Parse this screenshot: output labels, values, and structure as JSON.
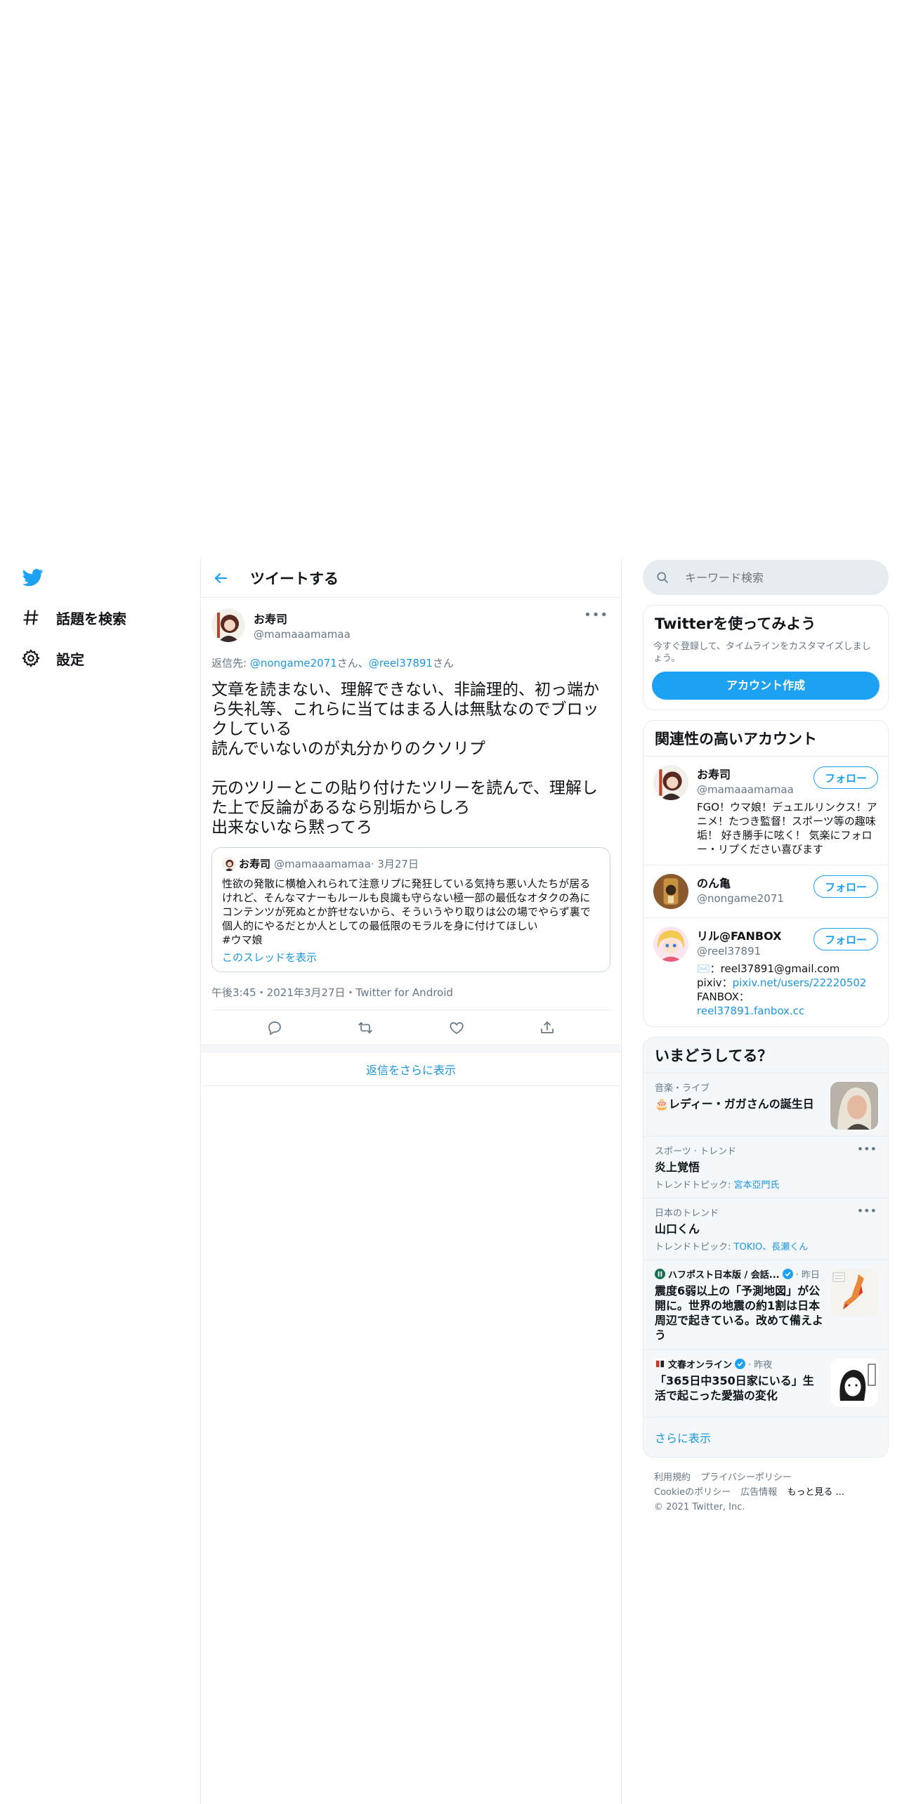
{
  "nav": {
    "items": [
      {
        "label": "話題を検索",
        "icon": "hashtag-icon"
      },
      {
        "label": "設定",
        "icon": "gear-icon"
      }
    ]
  },
  "main": {
    "title": "ツイートする",
    "tweet": {
      "author_name": "お寿司",
      "author_handle": "@mamaaamamaa",
      "reply_prefix": "返信先: ",
      "reply_user1": "@nongame2071",
      "reply_san1": "さん、",
      "reply_user2": "@reel37891",
      "reply_san2": "さん",
      "text": "文章を読まない、理解できない、非論理的、初っ端から失礼等、これらに当てはまる人は無駄なのでブロックしている\n読んでいないのが丸分かりのクソリプ\n\n元のツリーとこの貼り付けたツリーを読んで、理解した上で反論があるなら別垢からしろ\n出来ないなら黙ってろ",
      "meta": "午後3:45・2021年3月27日・Twitter for Android"
    },
    "quote": {
      "author_name": "お寿司",
      "author_handle": "@mamaaamamaa",
      "date": "· 3月27日",
      "text": "性欲の発散に横槍入れられて注意リプに発狂している気持ち悪い人たちが居るけれど、そんなマナーもルールも良識も守らない極一部の最低なオタクの為にコンテンツが死ぬとか許せないから、そういうやり取りは公の場でやらず裏で個人的にやるだとか人としての最低限のモラルを身に付けてほしい\n#ウマ娘",
      "thread_link": "このスレッドを表示"
    },
    "show_more_replies": "返信をさらに表示"
  },
  "sidebar": {
    "search_placeholder": "キーワード検索",
    "signup": {
      "title": "Twitterを使ってみよう",
      "desc": "今すぐ登録して、タイムラインをカスタマイズしましょう。",
      "button": "アカウント作成"
    },
    "related": {
      "title": "関連性の高いアカウント",
      "follow_label": "フォロー",
      "accounts": [
        {
          "name": "お寿司",
          "handle": "@mamaaamamaa",
          "bio": "FGO！ウマ娘！デュエルリンクス！アニメ！たつき監督！スポーツ等の趣味垢！ 好き勝手に呟く！ 気楽にフォロー・リプください喜びます"
        },
        {
          "name": "のん亀",
          "handle": "@nongame2071",
          "bio": ""
        },
        {
          "name": "リル@FANBOX",
          "handle": "@reel37891",
          "bio_prefix": "✉️：reel37891@gmail.com pixiv：",
          "bio_link1": "pixiv.net/users/22220502",
          "bio_mid": " FANBOX：",
          "bio_link2": "reel37891.fanbox.cc"
        }
      ]
    },
    "trends": {
      "title": "いまどうしてる？",
      "items": [
        {
          "meta": "音楽・ライブ",
          "title": "🎂レディー・ガガさんの誕生日"
        },
        {
          "meta": "スポーツ · トレンド",
          "title": "炎上覚悟",
          "topics_prefix": "トレンドトピック: ",
          "topics": "宮本亞門氏"
        },
        {
          "meta": "日本のトレンド",
          "title": "山口くん",
          "topics_prefix": "トレンドトピック: ",
          "topics": "TOKIO、長瀬くん"
        },
        {
          "source": "ハフポスト日本版 / 会話...",
          "time": "· 昨日",
          "title": "震度6弱以上の「予測地図」が公開に。世界の地震の約1割は日本周辺で起きている。改めて備えよう"
        },
        {
          "source": "文春オンライン",
          "time": "· 昨夜",
          "title": "「365日中350日家にいる」生活で起こった愛猫の変化"
        }
      ],
      "more": "さらに表示"
    },
    "footer": {
      "links": [
        "利用規約",
        "プライバシーポリシー",
        "Cookieのポリシー",
        "広告情報",
        "もっと見る ..."
      ],
      "copyright": "© 2021 Twitter, Inc."
    }
  },
  "colors": {
    "accent": "#1da1f2",
    "link": "#1b95e0",
    "muted": "#657786",
    "border": "#e6ecf0"
  }
}
